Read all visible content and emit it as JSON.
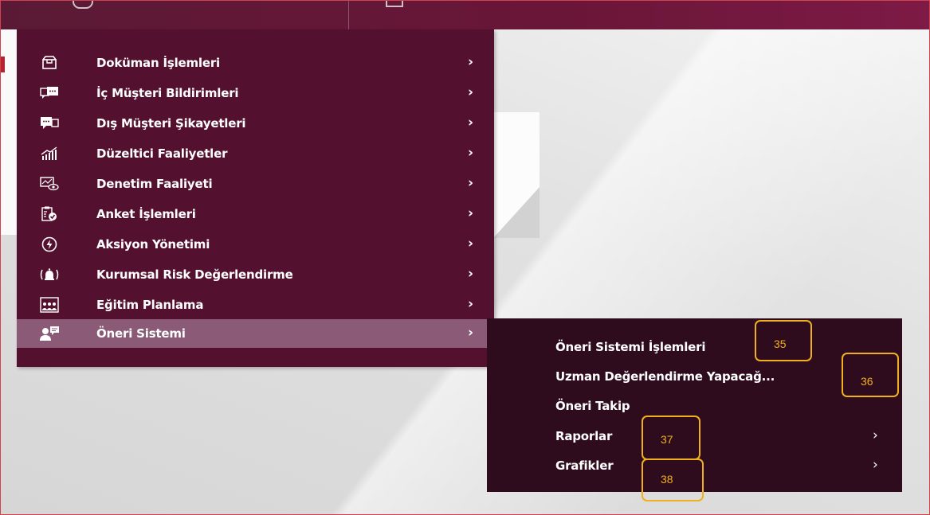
{
  "menu": {
    "items": [
      {
        "label": "Doküman İşlemleri",
        "icon": "box-icon"
      },
      {
        "label": "İç Müşteri Bildirimleri",
        "icon": "chat-icon"
      },
      {
        "label": "Dış Müşteri Şikayetleri",
        "icon": "chat-reverse-icon"
      },
      {
        "label": "Düzeltici Faaliyetler",
        "icon": "chart-up-icon"
      },
      {
        "label": "Denetim Faaliyeti",
        "icon": "inspect-icon"
      },
      {
        "label": "Anket İşlemleri",
        "icon": "clipboard-check-icon"
      },
      {
        "label": "Aksiyon Yönetimi",
        "icon": "lightning-icon"
      },
      {
        "label": "Kurumsal Risk Değerlendirme",
        "icon": "alarm-icon"
      },
      {
        "label": "Eğitim Planlama",
        "icon": "training-icon"
      },
      {
        "label": "Öneri Sistemi",
        "icon": "user-comment-icon"
      }
    ],
    "active_index": 9
  },
  "submenu": {
    "items": [
      {
        "label": "Öneri Sistemi İşlemleri",
        "has_children": false
      },
      {
        "label": "Uzman Değerlendirme Yapacağ...",
        "has_children": false
      },
      {
        "label": "Öneri Takip",
        "has_children": false
      },
      {
        "label": "Raporlar",
        "has_children": true
      },
      {
        "label": "Grafikler",
        "has_children": true
      }
    ]
  },
  "callouts": [
    "35",
    "36",
    "37",
    "38"
  ],
  "colors": {
    "menu_bg": "#54112f",
    "active_bg": "#8a5a76",
    "submenu_bg": "#2e0c1e",
    "callout": "#f0b01c"
  }
}
